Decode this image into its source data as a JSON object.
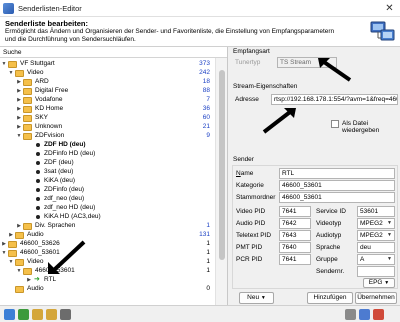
{
  "window": {
    "title": "Senderlisten-Editor"
  },
  "header": {
    "title": "Senderliste bearbeiten:",
    "description": "Ermöglicht das Ändern und Organisieren der Sender- und Favoritenliste, die Einstellung von Empfangsparametern und die Durchführung von Sendersuchläufen."
  },
  "list": {
    "column_header": "Suche",
    "rows": [
      {
        "label": "VF Stuttgart",
        "count": "373",
        "count_blue": true
      },
      {
        "label": "Video",
        "count": "242"
      },
      {
        "label": "ARD",
        "count": "18"
      },
      {
        "label": "Digital Free",
        "count": "88"
      },
      {
        "label": "Vodafone",
        "count": "7"
      },
      {
        "label": "KD Home",
        "count": "36"
      },
      {
        "label": "SKY",
        "count": "60"
      },
      {
        "label": "Unknown",
        "count": "21"
      },
      {
        "label": "ZDFvision",
        "count": "9"
      },
      {
        "label": "ZDF HD (deu)"
      },
      {
        "label": "ZDFinfo HD (deu)"
      },
      {
        "label": "ZDF (deu)"
      },
      {
        "label": "3sat (deu)"
      },
      {
        "label": "KiKA (deu)"
      },
      {
        "label": "ZDFinfo (deu)"
      },
      {
        "label": "zdf_neo (deu)"
      },
      {
        "label": "zdf_neo HD (deu)"
      },
      {
        "label": "KiKA HD (AC3,deu)"
      },
      {
        "label": "Div. Sprachen",
        "count": "1"
      },
      {
        "label": "Audio",
        "count": "131"
      },
      {
        "label": "46600_53626",
        "count": "1"
      },
      {
        "label": "46600_53601",
        "count": "1"
      },
      {
        "label": "Video",
        "count": "1"
      },
      {
        "label": "46600_53601",
        "count": "1"
      },
      {
        "label": "RTL"
      },
      {
        "label": "Audio",
        "count": "0"
      }
    ]
  },
  "reception": {
    "group": "Empfangsart",
    "tunertyp_label": "Tunertyp",
    "tunertyp_value": "TS Stream"
  },
  "stream": {
    "group": "Stream-Eigenschaften",
    "address_label": "Adresse",
    "address_value": "rtsp://192.168.178.1:554/?avm=1&freq=466&",
    "play_as_file_label": "Als Datei wiedergeben"
  },
  "sender": {
    "group": "Sender",
    "name_label": "Name",
    "name_value": "RTL",
    "kategorie_label": "Kategorie",
    "kategorie_value": "46600_53601",
    "stammordner_label": "Stammordner",
    "stammordner_value": "46600_53601",
    "video_pid_label": "Video PID",
    "video_pid_value": "7641",
    "service_id_label": "Service ID",
    "service_id_value": "53601",
    "audio_pid_label": "Audio PID",
    "audio_pid_value": "7642",
    "videotyp_label": "Videotyp",
    "videotyp_value": "MPEG2",
    "teletext_pid_label": "Teletext PID",
    "teletext_pid_value": "7643",
    "audiotyp_label": "Audiotyp",
    "audiotyp_value": "MPEG2",
    "pmt_pid_label": "PMT PID",
    "pmt_pid_value": "7640",
    "sprache_label": "Sprache",
    "sprache_value": "deu",
    "pcr_pid_label": "PCR PID",
    "pcr_pid_value": "7641",
    "gruppe_label": "Gruppe",
    "gruppe_value": "A",
    "sendernr_label": "Sendernr.",
    "epg_label": "EPG"
  },
  "buttons": {
    "new": "Neu",
    "add": "Hinzufügen",
    "apply": "Übernehmen"
  },
  "toolbar": {
    "icons": [
      "refresh-icon",
      "undo-icon",
      "expand-icon",
      "collapse-icon",
      "sort-icon",
      "separator",
      "move-icon",
      "save-icon",
      "delete-icon"
    ]
  },
  "colors": {
    "count_blue": "#1a3fc4",
    "folder": "#f5c04a",
    "arrow": "#2aa12a"
  }
}
